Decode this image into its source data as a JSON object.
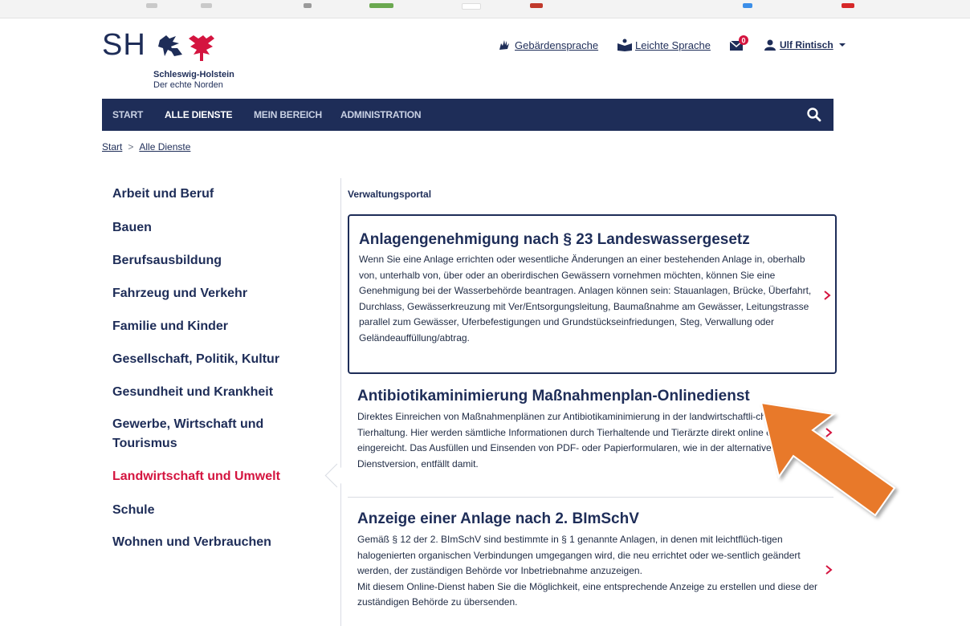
{
  "logo": {
    "mark": "SH",
    "state": "Schleswig-Holstein",
    "claim": "Der echte Norden"
  },
  "utility": {
    "sign_language": "Gebärdensprache",
    "easy_language": "Leichte Sprache",
    "notification_count": "0",
    "user_name": "Ulf Rintisch"
  },
  "nav": {
    "items": [
      "START",
      "ALLE DIENSTE",
      "MEIN BEREICH",
      "ADMINISTRATION"
    ],
    "active": "ALLE DIENSTE"
  },
  "breadcrumb": {
    "items": [
      "Start",
      "Alle Dienste"
    ],
    "separator": ">"
  },
  "sidebar": {
    "items": [
      "Arbeit und Beruf",
      "Bauen",
      "Berufsausbildung",
      "Fahrzeug und Verkehr",
      "Familie und Kinder",
      "Gesellschaft, Politik, Kultur",
      "Gesundheit und Krankheit",
      "Gewerbe, Wirtschaft und Tourismus",
      "Landwirtschaft und Umwelt",
      "Schule",
      "Wohnen und Verbrauchen"
    ],
    "active": "Landwirtschaft und Umwelt"
  },
  "content": {
    "section_label": "Verwaltungsportal",
    "services": [
      {
        "title": "Anlagengenehmigung nach § 23 Landeswassergesetz",
        "description": "Wenn Sie eine Anlage errichten oder wesentliche Änderungen an einer bestehenden Anlage in, oberhalb von, unterhalb von, über oder an oberirdischen Gewässern vornehmen möchten, können Sie eine Genehmigung bei der Wasserbehörde beantragen. Anlagen können sein: Stauanlagen, Brücke, Überfahrt, Durchlass, Gewässerkreuzung mit Ver/Entsorgungsleitung, Baumaßnahme am Gewässer, Leitungstrasse parallel zum Gewässer, Uferbefestigungen und Grundstückseinfriedungen, Steg, Verwallung oder Geländeauffüllung/abtrag."
      },
      {
        "title": "Antibiotikaminimierung Maßnahmenplan-Onlinedienst",
        "description": "Direktes Einreichen von Maßnahmenplänen zur Antibiotikaminimierung in der landwirtschaftli-chen Tierhaltung. Hier werden sämtliche Informationen durch Tierhaltende und Tierärzte direkt online erfasst und eingereicht. Das Ausfüllen und Einsenden von PDF- oder Papierformularen, wie in der alternativen Dienstversion, entfällt damit."
      },
      {
        "title": "Anzeige einer Anlage nach 2. BImSchV",
        "description": "Gemäß § 12 der 2. BImSchV sind bestimmte in § 1 genannte Anlagen, in denen mit leichtflüch-tigen halogenierten organischen Verbindungen umgegangen wird, die neu errichtet oder we-sentlich geändert werden, der zuständigen Behörde vor Inbetriebnahme anzuzeigen.",
        "description_2": "Mit diesem Online-Dienst haben Sie die Möglichkeit, eine entsprechende Anzeige zu erstellen und diese der zuständigen Behörde zu übersenden."
      }
    ]
  },
  "colors": {
    "brand": "#1e2d58",
    "active_red": "#d4143f",
    "annotation_arrow": "#e8792b",
    "chevron": "#d4143f"
  },
  "icons": [
    "sign-language-icon",
    "easy-language-icon",
    "notification-icon",
    "user-icon",
    "caret-down-icon",
    "search-icon",
    "chevron-right-icon"
  ]
}
